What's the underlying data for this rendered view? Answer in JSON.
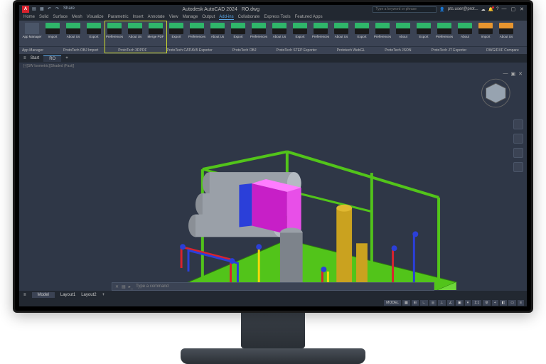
{
  "title": {
    "app": "Autodesk AutoCAD 2024",
    "file": "RO.dwg"
  },
  "qat": {
    "share": "Share"
  },
  "search_ph": "Type a keyword or phrase",
  "user": "pts.user@prot...",
  "menu": [
    "Home",
    "Solid",
    "Surface",
    "Mesh",
    "Visualize",
    "Parametric",
    "Insert",
    "Annotate",
    "View",
    "Manage",
    "Output",
    "Add-ins",
    "Collaborate",
    "Express Tools",
    "Featured Apps"
  ],
  "menu_active": 11,
  "ribbon_buttons": [
    {
      "l": "App Manager",
      "single": true
    },
    {
      "l": "Import"
    },
    {
      "l": "About Us"
    },
    {
      "l": "Export"
    },
    {
      "l": "Preferences"
    },
    {
      "l": "About Us"
    },
    {
      "l": "Merge PDF"
    },
    {
      "l": "Export"
    },
    {
      "l": "Preferences"
    },
    {
      "l": "About Us"
    },
    {
      "l": "Export"
    },
    {
      "l": "Preferences"
    },
    {
      "l": "About Us"
    },
    {
      "l": "Export"
    },
    {
      "l": "Preferences"
    },
    {
      "l": "About Us"
    },
    {
      "l": "Export"
    },
    {
      "l": "Preferences"
    },
    {
      "l": "About"
    },
    {
      "l": "Export"
    },
    {
      "l": "Preferences"
    },
    {
      "l": "About"
    },
    {
      "l": "Import",
      "orange": true
    },
    {
      "l": "About Us",
      "orange": true
    }
  ],
  "ribbon_groups": [
    "App Manager",
    "ProtoTech OBJ Import",
    "ProtoTech 3DPDF",
    "ProtoTech CATIAV5 Exporter",
    "ProtoTech OBJ",
    "ProtoTech STEP Exporter",
    "Prototech WebGL",
    "ProtoTech JSON",
    "ProtoTech JT Exporter",
    "DWG/DXF Compare"
  ],
  "file_tabs": {
    "start": "Start",
    "current": "RO"
  },
  "view_label": "[-][SW Isometric][Shaded (Fast)]",
  "cmd": {
    "prompt": "Type a command"
  },
  "layouts": [
    "Model",
    "Layout1",
    "Layout2"
  ],
  "status": {
    "model": "MODEL",
    "scale": "1:1"
  }
}
